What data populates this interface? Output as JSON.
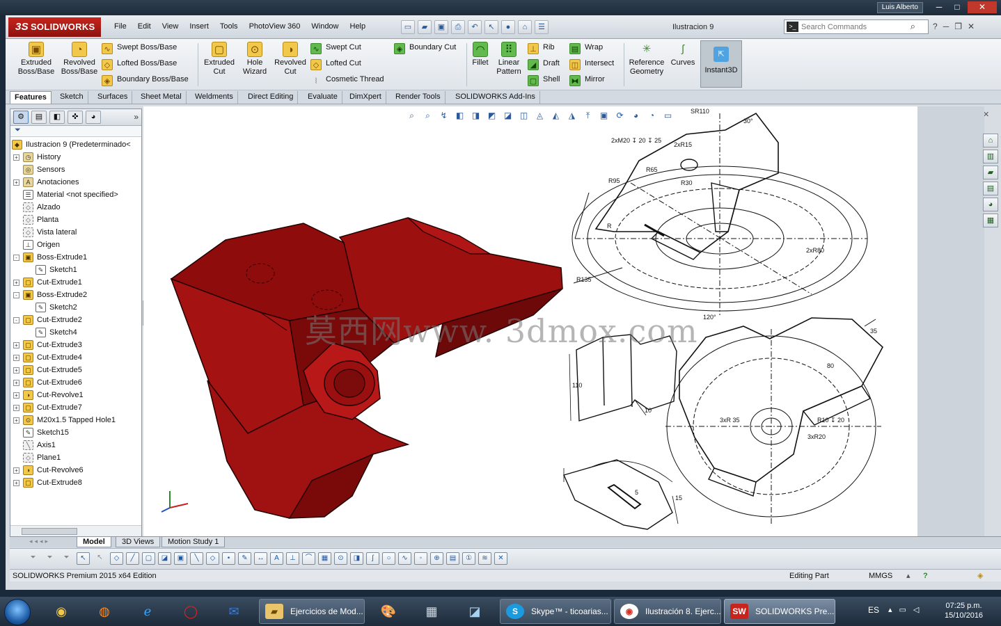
{
  "window": {
    "user": "Luis Alberto",
    "minimize": "─",
    "maximize": "□",
    "close": "✕"
  },
  "menubar": {
    "logo_ds": "3S",
    "logo_text": "SOLIDWORKS",
    "items": [
      "File",
      "Edit",
      "View",
      "Insert",
      "Tools",
      "PhotoView 360",
      "Window",
      "Help"
    ],
    "document_title": "Ilustracion 9",
    "search_placeholder": "Search Commands"
  },
  "commands": {
    "extruded_boss": "Extruded Boss/Base",
    "revolved_boss": "Revolved Boss/Base",
    "swept_boss": "Swept Boss/Base",
    "lofted_boss": "Lofted Boss/Base",
    "boundary_boss": "Boundary Boss/Base",
    "extruded_cut": "Extruded Cut",
    "hole_wizard": "Hole Wizard",
    "revolved_cut": "Revolved Cut",
    "swept_cut": "Swept Cut",
    "lofted_cut": "Lofted Cut",
    "boundary_cut": "Boundary Cut",
    "cosmetic_thread": "Cosmetic Thread",
    "fillet": "Fillet",
    "linear_pattern": "Linear Pattern",
    "rib": "Rib",
    "draft": "Draft",
    "shell": "Shell",
    "wrap": "Wrap",
    "intersect": "Intersect",
    "mirror": "Mirror",
    "reference_geometry": "Reference Geometry",
    "curves": "Curves",
    "instant3d": "Instant3D"
  },
  "tabs": [
    "Features",
    "Sketch",
    "Surfaces",
    "Sheet Metal",
    "Weldments",
    "Direct Editing",
    "Evaluate",
    "DimXpert",
    "Render Tools",
    "SOLIDWORKS Add-Ins"
  ],
  "tree": {
    "root": "Ilustracion 9  (Predeterminado<",
    "items": [
      {
        "label": "History",
        "icon": "history-icon",
        "level": 1,
        "exp": "+"
      },
      {
        "label": "Sensors",
        "icon": "sensor-icon",
        "level": 1,
        "exp": ""
      },
      {
        "label": "Anotaciones",
        "icon": "annotation-icon",
        "level": 1,
        "exp": "+"
      },
      {
        "label": "Material <not specified>",
        "icon": "material-icon",
        "level": 1,
        "exp": ""
      },
      {
        "label": "Alzado",
        "icon": "plane-icon",
        "level": 1,
        "exp": ""
      },
      {
        "label": "Planta",
        "icon": "plane-icon",
        "level": 1,
        "exp": ""
      },
      {
        "label": "Vista lateral",
        "icon": "plane-icon",
        "level": 1,
        "exp": ""
      },
      {
        "label": "Origen",
        "icon": "origin-icon",
        "level": 1,
        "exp": ""
      },
      {
        "label": "Boss-Extrude1",
        "icon": "extrude-icon",
        "level": 1,
        "exp": "-"
      },
      {
        "label": "Sketch1",
        "icon": "sketch-icon",
        "level": 2,
        "exp": ""
      },
      {
        "label": "Cut-Extrude1",
        "icon": "cut-icon",
        "level": 1,
        "exp": "+"
      },
      {
        "label": "Boss-Extrude2",
        "icon": "extrude-icon",
        "level": 1,
        "exp": "-"
      },
      {
        "label": "Sketch2",
        "icon": "sketch-icon",
        "level": 2,
        "exp": ""
      },
      {
        "label": "Cut-Extrude2",
        "icon": "cut-icon",
        "level": 1,
        "exp": "-"
      },
      {
        "label": "Sketch4",
        "icon": "sketch-icon",
        "level": 2,
        "exp": ""
      },
      {
        "label": "Cut-Extrude3",
        "icon": "cut-icon",
        "level": 1,
        "exp": "+"
      },
      {
        "label": "Cut-Extrude4",
        "icon": "cut-icon",
        "level": 1,
        "exp": "+"
      },
      {
        "label": "Cut-Extrude5",
        "icon": "cut-icon",
        "level": 1,
        "exp": "+"
      },
      {
        "label": "Cut-Extrude6",
        "icon": "cut-icon",
        "level": 1,
        "exp": "+"
      },
      {
        "label": "Cut-Revolve1",
        "icon": "revolve-icon",
        "level": 1,
        "exp": "+"
      },
      {
        "label": "Cut-Extrude7",
        "icon": "cut-icon",
        "level": 1,
        "exp": "+"
      },
      {
        "label": "M20x1.5 Tapped Hole1",
        "icon": "hole-icon",
        "level": 1,
        "exp": "+"
      },
      {
        "label": "Sketch15",
        "icon": "sketch-icon",
        "level": 1,
        "exp": ""
      },
      {
        "label": "Axis1",
        "icon": "axis-icon",
        "level": 1,
        "exp": ""
      },
      {
        "label": "Plane1",
        "icon": "plane-icon",
        "level": 1,
        "exp": ""
      },
      {
        "label": "Cut-Revolve6",
        "icon": "revolve-icon",
        "level": 1,
        "exp": "+"
      },
      {
        "label": "Cut-Extrude8",
        "icon": "cut-icon",
        "level": 1,
        "exp": "+"
      }
    ]
  },
  "drawing_labels": {
    "sr110": "SR110",
    "m20": "2xM20 ↧ 20 ↧ 25",
    "r15": "2xR15",
    "r65": "R65",
    "r95": "R95",
    "r30": "R30",
    "r": "R",
    "r80": "2xR80",
    "r135": "R135",
    "a30": "30°",
    "a120": "120°",
    "d110": "110",
    "d10": "10",
    "d35": "35",
    "d80": "80",
    "r35": "3xR 35",
    "r10": "R10 ↧ 20",
    "r20": "3xR20",
    "d5": "5",
    "d15": "15"
  },
  "watermark": "莫西网www. 3dmox.com",
  "bottom_tabs": [
    "Model",
    "3D Views",
    "Motion Study 1"
  ],
  "status": {
    "edition": "SOLIDWORKS Premium 2015 x64 Edition",
    "mode": "Editing Part",
    "units": "MMGS"
  },
  "taskbar": {
    "tasks": [
      "Ejercicios de Mod...",
      "Skype™ - ticoarias...",
      "Ilustración 8. Ejerc...",
      "SOLIDWORKS Pre..."
    ],
    "lang": "ES",
    "time": "07:25 p.m.",
    "date": "15/10/2016"
  },
  "colors": {
    "part_red": "#a80e0e",
    "sw_red": "#c8241d",
    "accent": "#2a5a9a"
  }
}
